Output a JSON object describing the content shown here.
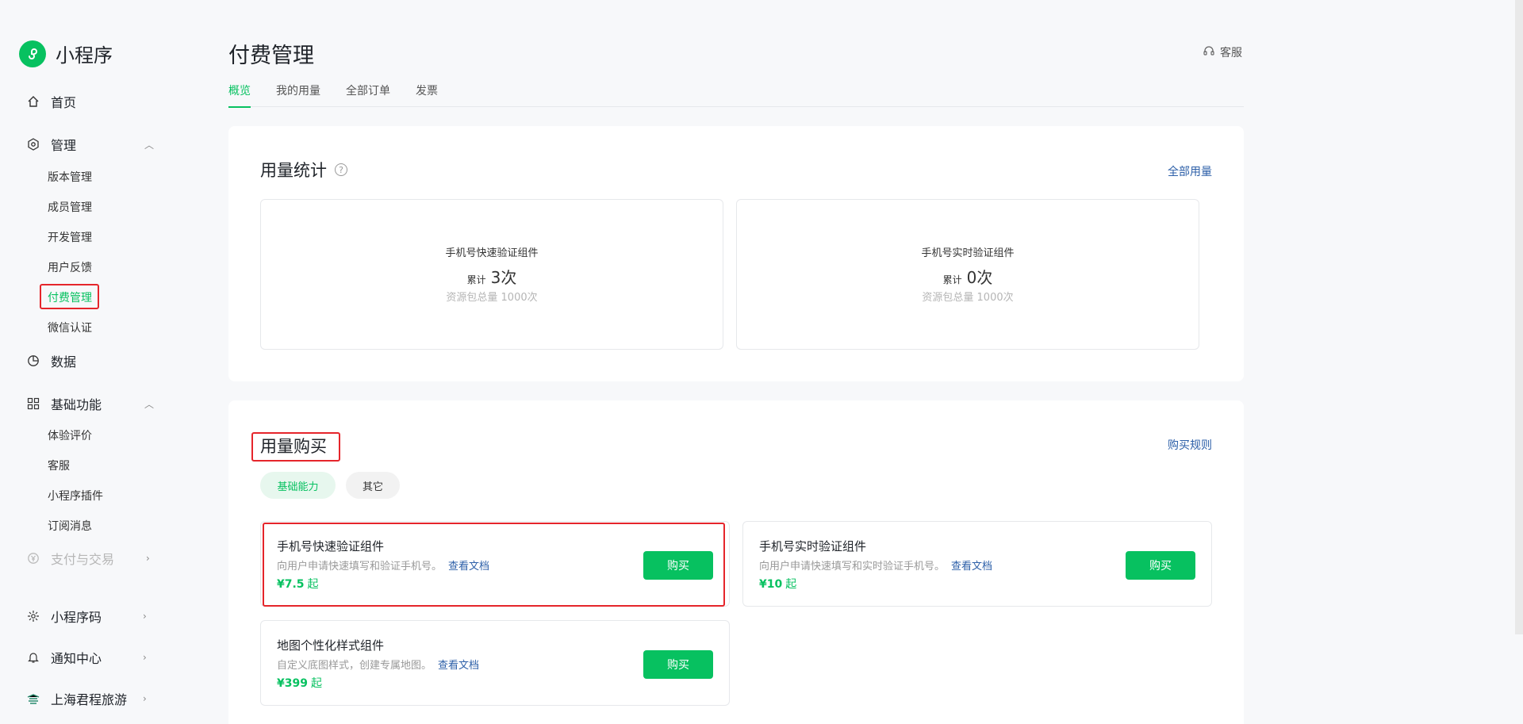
{
  "app": {
    "name": "小程序",
    "page_title": "付费管理",
    "support_label": "客服"
  },
  "sidebar": {
    "home": "首页",
    "manage": {
      "label": "管理",
      "items": [
        "版本管理",
        "成员管理",
        "开发管理",
        "用户反馈",
        "付费管理",
        "微信认证"
      ]
    },
    "data": "数据",
    "basic": {
      "label": "基础功能",
      "items": [
        "体验评价",
        "客服",
        "小程序插件",
        "订阅消息"
      ]
    },
    "payment": "支付与交易",
    "qrcode": "小程序码",
    "notify": "通知中心",
    "account": "上海君程旅游"
  },
  "tabs": [
    "概览",
    "我的用量",
    "全部订单",
    "发票"
  ],
  "usage": {
    "title": "用量统计",
    "all_link": "全部用量",
    "total_label": "累计",
    "cards": [
      {
        "name": "手机号快速验证组件",
        "count": "3次",
        "pack": "资源包总量 1000次"
      },
      {
        "name": "手机号实时验证组件",
        "count": "0次",
        "pack": "资源包总量 1000次"
      }
    ]
  },
  "purchase": {
    "title": "用量购买",
    "rules_link": "购买规则",
    "filters": [
      "基础能力",
      "其它"
    ],
    "doc_link": "查看文档",
    "buy_label": "购买",
    "price_suffix": "起",
    "products": [
      {
        "name": "手机号快速验证组件",
        "desc": "向用户申请快速填写和验证手机号。",
        "price": "¥7.5"
      },
      {
        "name": "手机号实时验证组件",
        "desc": "向用户申请快速填写和实时验证手机号。",
        "price": "¥10"
      },
      {
        "name": "地图个性化样式组件",
        "desc": "自定义底图样式，创建专属地图。",
        "price": "¥399"
      }
    ]
  },
  "colors": {
    "accent": "#07c160",
    "highlight": "#e5252b",
    "link": "#2c5fa8"
  }
}
